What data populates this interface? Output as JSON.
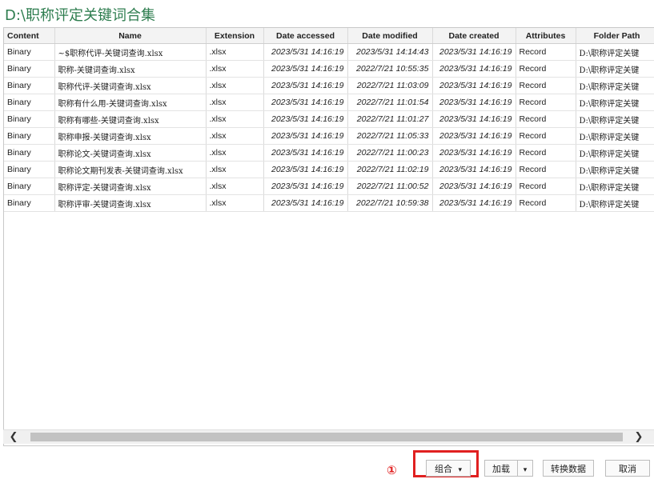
{
  "title": "D:\\职称评定关键词合集",
  "columns": [
    "Content",
    "Name",
    "Extension",
    "Date accessed",
    "Date modified",
    "Date created",
    "Attributes",
    "Folder Path"
  ],
  "rows": [
    {
      "content": "Binary",
      "name": "~$职称代评-关键词查询.xlsx",
      "ext": ".xlsx",
      "accessed": "2023/5/31 14:16:19",
      "modified": "2023/5/31 14:14:43",
      "created": "2023/5/31 14:16:19",
      "attr": "Record",
      "folder": "D:\\职称评定关键"
    },
    {
      "content": "Binary",
      "name": "职称-关键词查询.xlsx",
      "ext": ".xlsx",
      "accessed": "2023/5/31 14:16:19",
      "modified": "2022/7/21 10:55:35",
      "created": "2023/5/31 14:16:19",
      "attr": "Record",
      "folder": "D:\\职称评定关键"
    },
    {
      "content": "Binary",
      "name": "职称代评-关键词查询.xlsx",
      "ext": ".xlsx",
      "accessed": "2023/5/31 14:16:19",
      "modified": "2022/7/21 11:03:09",
      "created": "2023/5/31 14:16:19",
      "attr": "Record",
      "folder": "D:\\职称评定关键"
    },
    {
      "content": "Binary",
      "name": "职称有什么用-关键词查询.xlsx",
      "ext": ".xlsx",
      "accessed": "2023/5/31 14:16:19",
      "modified": "2022/7/21 11:01:54",
      "created": "2023/5/31 14:16:19",
      "attr": "Record",
      "folder": "D:\\职称评定关键"
    },
    {
      "content": "Binary",
      "name": "职称有哪些-关键词查询.xlsx",
      "ext": ".xlsx",
      "accessed": "2023/5/31 14:16:19",
      "modified": "2022/7/21 11:01:27",
      "created": "2023/5/31 14:16:19",
      "attr": "Record",
      "folder": "D:\\职称评定关键"
    },
    {
      "content": "Binary",
      "name": "职称申报-关键词查询.xlsx",
      "ext": ".xlsx",
      "accessed": "2023/5/31 14:16:19",
      "modified": "2022/7/21 11:05:33",
      "created": "2023/5/31 14:16:19",
      "attr": "Record",
      "folder": "D:\\职称评定关键"
    },
    {
      "content": "Binary",
      "name": "职称论文-关键词查询.xlsx",
      "ext": ".xlsx",
      "accessed": "2023/5/31 14:16:19",
      "modified": "2022/7/21 11:00:23",
      "created": "2023/5/31 14:16:19",
      "attr": "Record",
      "folder": "D:\\职称评定关键"
    },
    {
      "content": "Binary",
      "name": "职称论文期刊发表-关键词查询.xlsx",
      "ext": ".xlsx",
      "accessed": "2023/5/31 14:16:19",
      "modified": "2022/7/21 11:02:19",
      "created": "2023/5/31 14:16:19",
      "attr": "Record",
      "folder": "D:\\职称评定关键"
    },
    {
      "content": "Binary",
      "name": "职称评定-关键词查询.xlsx",
      "ext": ".xlsx",
      "accessed": "2023/5/31 14:16:19",
      "modified": "2022/7/21 11:00:52",
      "created": "2023/5/31 14:16:19",
      "attr": "Record",
      "folder": "D:\\职称评定关键"
    },
    {
      "content": "Binary",
      "name": "职称评审-关键词查询.xlsx",
      "ext": ".xlsx",
      "accessed": "2023/5/31 14:16:19",
      "modified": "2022/7/21 10:59:38",
      "created": "2023/5/31 14:16:19",
      "attr": "Record",
      "folder": "D:\\职称评定关键"
    }
  ],
  "scroll": {
    "left_icon": "chevron-left-icon",
    "right_icon": "chevron-right-icon",
    "left_glyph": "❮",
    "right_glyph": "❯"
  },
  "buttons": {
    "combine": "组合",
    "combine_caret": "▾",
    "load": "加载",
    "load_caret": "▾",
    "transform": "转换数据",
    "cancel": "取消"
  },
  "annotation": {
    "marker": "①",
    "color": "#e02020"
  },
  "colors": {
    "title": "#2e7d4f",
    "header_bg": "#f3f3f3"
  }
}
